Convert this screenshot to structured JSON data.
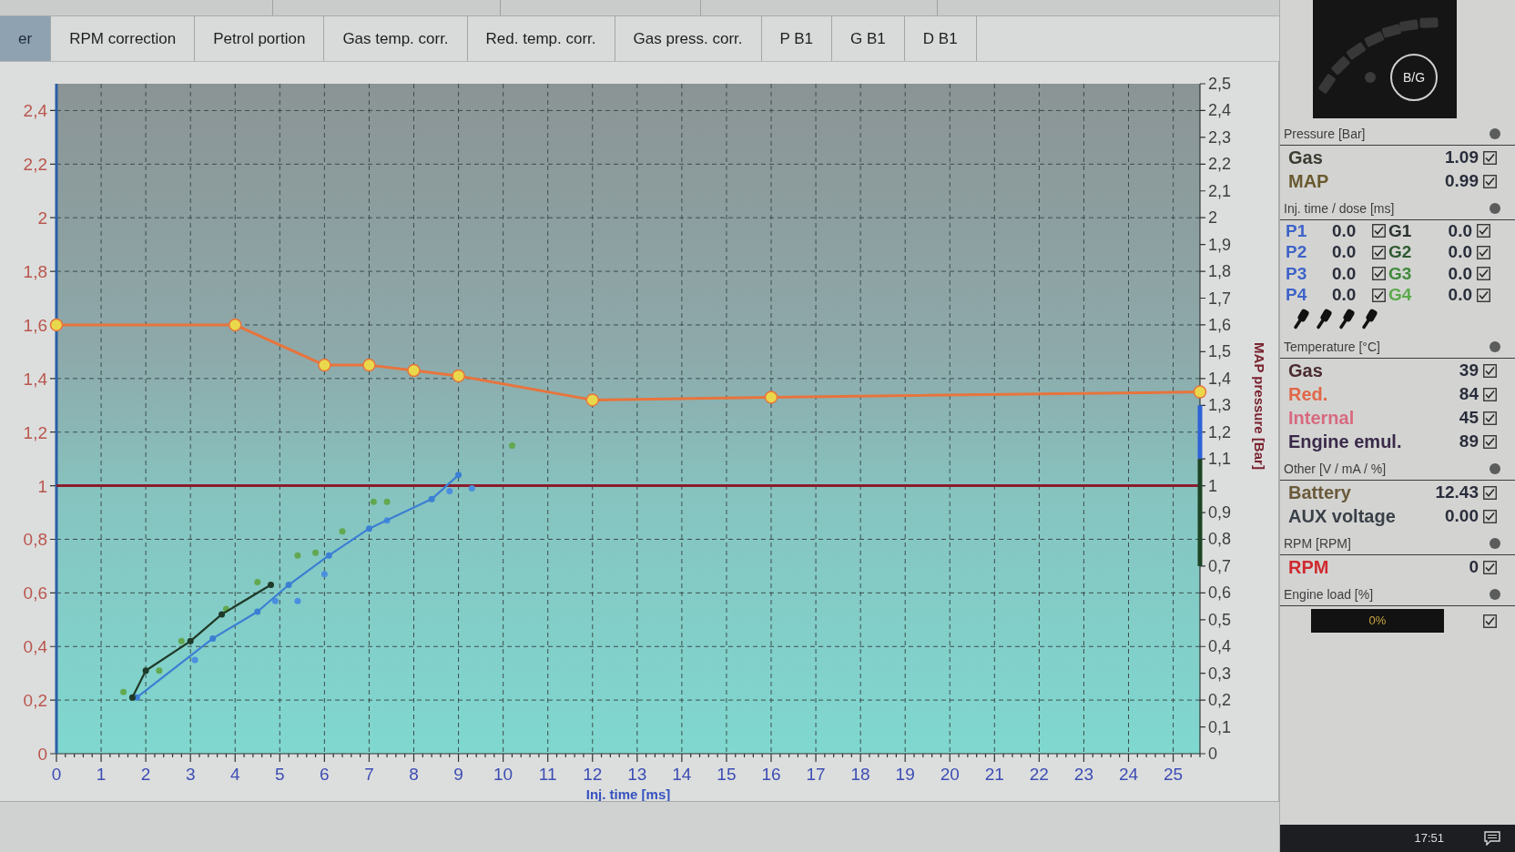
{
  "tabs": [
    {
      "label": "er",
      "selected": true
    },
    {
      "label": "RPM correction",
      "selected": false
    },
    {
      "label": "Petrol portion",
      "selected": false
    },
    {
      "label": "Gas temp. corr.",
      "selected": false
    },
    {
      "label": "Red. temp. corr.",
      "selected": false
    },
    {
      "label": "Gas press. corr.",
      "selected": false
    },
    {
      "label": "P B1",
      "selected": false
    },
    {
      "label": "G B1",
      "selected": false
    },
    {
      "label": "D B1",
      "selected": false
    }
  ],
  "chart": {
    "chart_data": [
      {
        "type": "line",
        "xlabel": "Inj. time [ms]",
        "y2label": "MAP pressure [Bar]",
        "xlim": [
          0,
          25.6
        ],
        "ylim": [
          0,
          2.5
        ],
        "y2lim": [
          0,
          2.5
        ],
        "xticks": [
          0,
          1,
          2,
          3,
          4,
          5,
          6,
          7,
          8,
          9,
          10,
          11,
          12,
          13,
          14,
          15,
          16,
          17,
          18,
          19,
          20,
          21,
          22,
          23,
          24,
          25
        ],
        "yticks": [
          {
            "value": 0,
            "label": "0"
          },
          {
            "value": 0.2,
            "label": "0,2"
          },
          {
            "value": 0.4,
            "label": "0,4"
          },
          {
            "value": 0.6,
            "label": "0,6"
          },
          {
            "value": 0.8,
            "label": "0,8"
          },
          {
            "value": 1,
            "label": "1"
          },
          {
            "value": 1.2,
            "label": "1,2"
          },
          {
            "value": 1.4,
            "label": "1,4"
          },
          {
            "value": 1.6,
            "label": "1,6"
          },
          {
            "value": 1.8,
            "label": "1,8"
          },
          {
            "value": 2,
            "label": "2"
          },
          {
            "value": 2.2,
            "label": "2,2"
          },
          {
            "value": 2.4,
            "label": "2,4"
          }
        ],
        "y2ticks": [
          {
            "value": 0,
            "label": "0"
          },
          {
            "value": 0.1,
            "label": "0,1"
          },
          {
            "value": 0.2,
            "label": "0,2"
          },
          {
            "value": 0.3,
            "label": "0,3"
          },
          {
            "value": 0.4,
            "label": "0,4"
          },
          {
            "value": 0.5,
            "label": "0,5"
          },
          {
            "value": 0.6,
            "label": "0,6"
          },
          {
            "value": 0.7,
            "label": "0,7"
          },
          {
            "value": 0.8,
            "label": "0,8"
          },
          {
            "value": 0.9,
            "label": "0,9"
          },
          {
            "value": 1,
            "label": "1"
          },
          {
            "value": 1.1,
            "label": "1,1"
          },
          {
            "value": 1.2,
            "label": "1,2"
          },
          {
            "value": 1.3,
            "label": "1,3"
          },
          {
            "value": 1.4,
            "label": "1,4"
          },
          {
            "value": 1.5,
            "label": "1,5"
          },
          {
            "value": 1.6,
            "label": "1,6"
          },
          {
            "value": 1.7,
            "label": "1,7"
          },
          {
            "value": 1.8,
            "label": "1,8"
          },
          {
            "value": 1.9,
            "label": "1,9"
          },
          {
            "value": 2,
            "label": "2"
          },
          {
            "value": 2.1,
            "label": "2,1"
          },
          {
            "value": 2.2,
            "label": "2,2"
          },
          {
            "value": 2.3,
            "label": "2,3"
          },
          {
            "value": 2.4,
            "label": "2,4"
          },
          {
            "value": 2.5,
            "label": "2,5"
          }
        ],
        "grid": true,
        "series": [
          {
            "color": "#2a5fa6",
            "x": [
              0,
              0
            ],
            "values": [
              0,
              2.5
            ]
          },
          {
            "color": "#8b1c2c",
            "x": [
              0,
              25.6
            ],
            "values": [
              1,
              1
            ]
          },
          {
            "type": "scatter",
            "color": "#62a84f",
            "x": [
              1.5,
              2.3,
              2.8,
              3.8,
              4.5,
              5.4,
              5.8,
              6.4,
              7.1,
              7.4,
              10.2
            ],
            "values": [
              0.23,
              0.31,
              0.42,
              0.54,
              0.64,
              0.74,
              0.75,
              0.83,
              0.94,
              0.94,
              1.15
            ]
          },
          {
            "type": "scatter",
            "color": "#4a8fe0",
            "x": [
              3.1,
              4.9,
              5.4,
              6,
              7.4,
              8.8,
              9.3
            ],
            "values": [
              0.35,
              0.57,
              0.57,
              0.67,
              0.87,
              0.98,
              0.99
            ]
          },
          {
            "color": "#3b7fd4",
            "marker": "dot",
            "x": [
              1.8,
              3.5,
              4.5,
              5.2,
              6.1,
              7,
              8.4,
              9
            ],
            "values": [
              0.21,
              0.43,
              0.53,
              0.63,
              0.74,
              0.84,
              0.95,
              1.04
            ]
          },
          {
            "color": "#1f3a28",
            "marker": "dot",
            "x": [
              1.7,
              2,
              3,
              3.7,
              4.8
            ],
            "values": [
              0.21,
              0.31,
              0.42,
              0.52,
              0.63
            ]
          },
          {
            "color": "#2f62d8",
            "axis": "y2",
            "x": [
              25.6,
              25.6
            ],
            "values": [
              1.1,
              1.3
            ]
          },
          {
            "color": "#1e4426",
            "axis": "y2",
            "x": [
              25.6,
              25.6
            ],
            "values": [
              0.7,
              1.1
            ]
          },
          {
            "color": "#e8743c",
            "marker": "circle",
            "x": [
              0,
              4,
              6,
              7,
              8,
              9,
              12,
              16,
              25.6
            ],
            "values": [
              1.6,
              1.6,
              1.45,
              1.45,
              1.43,
              1.41,
              1.32,
              1.33,
              1.35
            ]
          }
        ]
      }
    ]
  },
  "side_panel": {
    "gauge_button": "B/G",
    "sections": [
      {
        "kind": "values",
        "title": "Pressure [Bar]",
        "rows": [
          {
            "label": "Gas",
            "value": "1.09",
            "checked": true,
            "color": "#3a3c30"
          },
          {
            "label": "MAP",
            "value": "0.99",
            "checked": true,
            "color": "#6a5a30"
          }
        ]
      },
      {
        "kind": "injectors",
        "title": "Inj. time / dose [ms]",
        "rows": [
          {
            "petrol": {
              "label": "P1",
              "value": "0.0",
              "checked": true,
              "color": "#3f63c8"
            },
            "gas": {
              "label": "G1",
              "value": "0.0",
              "checked": true,
              "color": "#2b3330"
            }
          },
          {
            "petrol": {
              "label": "P2",
              "value": "0.0",
              "checked": true,
              "color": "#3f63c8"
            },
            "gas": {
              "label": "G2",
              "value": "0.0",
              "checked": true,
              "color": "#2f5a30"
            }
          },
          {
            "petrol": {
              "label": "P3",
              "value": "0.0",
              "checked": true,
              "color": "#3f63c8"
            },
            "gas": {
              "label": "G3",
              "value": "0.0",
              "checked": true,
              "color": "#3f8a3a"
            }
          },
          {
            "petrol": {
              "label": "P4",
              "value": "0.0",
              "checked": true,
              "color": "#3f63c8"
            },
            "gas": {
              "label": "G4",
              "value": "0.0",
              "checked": true,
              "color": "#5aaa4a"
            }
          }
        ]
      },
      {
        "kind": "values",
        "title": "Temperature [°C]",
        "rows": [
          {
            "label": "Gas",
            "value": "39",
            "checked": true,
            "color": "#4a2a30"
          },
          {
            "label": "Red.",
            "value": "84",
            "checked": true,
            "color": "#e0684a"
          },
          {
            "label": "Internal",
            "value": "45",
            "checked": true,
            "color": "#d86a80"
          },
          {
            "label": "Engine emul.",
            "value": "89",
            "checked": true,
            "color": "#3a2a4a"
          }
        ]
      },
      {
        "kind": "values",
        "title": "Other [V / mA / %]",
        "rows": [
          {
            "label": "Battery",
            "value": "12.43",
            "checked": true,
            "color": "#6a5a3a"
          },
          {
            "label": "AUX voltage",
            "value": "0.00",
            "checked": true,
            "color": "#3a4048"
          }
        ]
      },
      {
        "kind": "values",
        "title": "RPM [RPM]",
        "rows": [
          {
            "label": "RPM",
            "value": "0",
            "checked": true,
            "color": "#d02a30"
          }
        ]
      },
      {
        "kind": "load",
        "title": "Engine load [%]",
        "reading": "0%",
        "checked": true
      }
    ]
  },
  "taskbar": {
    "clock": "17:51"
  }
}
